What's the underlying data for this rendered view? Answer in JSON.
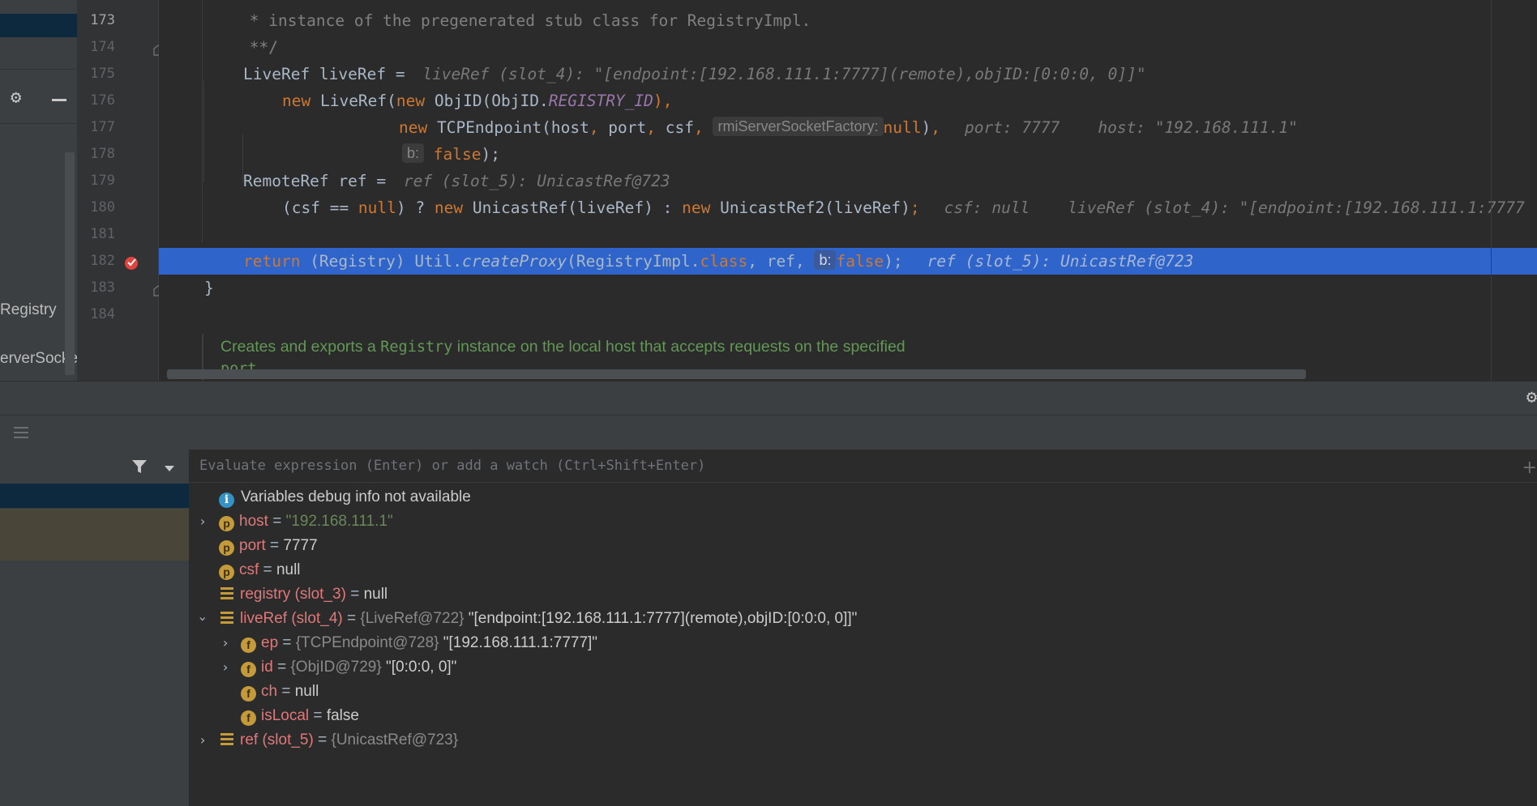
{
  "sidebar": {
    "labels": [
      "Registry",
      "erverSocket"
    ],
    "settings_icon": "gear-icon",
    "hide_icon": "minus-icon"
  },
  "editor": {
    "line_numbers": [
      "173",
      "174",
      "175",
      "176",
      "177",
      "178",
      "179",
      "180",
      "181",
      "182",
      "183",
      "184"
    ],
    "l173": " * instance of the pregenerated stub class for RegistryImpl.",
    "l174": " **/",
    "l175_code": "LiveRef liveRef = ",
    "l175_hint": "liveRef (slot_4): \"[endpoint:[192.168.111.1:7777](remote),objID:[0:0:0, 0]]\"",
    "l176_new1": "new ",
    "l176_a": "LiveRef(",
    "l176_new2": "new ",
    "l176_b": "ObjID(ObjID.",
    "l176_const": "REGISTRY_ID",
    "l176_c": "),",
    "l177_new": "new ",
    "l177_a": "TCPEndpoint(host",
    "l177_comma1": ", ",
    "l177_b": "port",
    "l177_comma2": ", ",
    "l177_c": "csf",
    "l177_comma3": ", ",
    "l177_param": "rmiServerSocketFactory:",
    "l177_null": "null",
    "l177_d": ")",
    "l177_comma4": ",",
    "l177_hint": "port: 7777    host: \"192.168.111.1\"",
    "l178_param": "b:",
    "l178_false": "false",
    "l178_end": ");",
    "l179_code": "RemoteRef ref = ",
    "l179_hint": "ref (slot_5): UnicastRef@723",
    "l180_a": "(csf == ",
    "l180_null": "null",
    "l180_b": ") ? ",
    "l180_new1": "new ",
    "l180_c": "UnicastRef(liveRef) : ",
    "l180_new2": "new ",
    "l180_d": "UnicastRef2(liveRef)",
    "l180_semi": ";",
    "l180_hint": "csf: null    liveRef (slot_4): \"[endpoint:[192.168.111.1:7777",
    "l182_return": "return ",
    "l182_a": "(Registry) Util.",
    "l182_method": "createProxy",
    "l182_b": "(RegistryImpl.",
    "l182_class": "class",
    "l182_c": ", ref, ",
    "l182_param": "b:",
    "l182_false": "false",
    "l182_end": ");",
    "l182_hint": "ref (slot_5): UnicastRef@723",
    "l183": "}",
    "doc_line1_a": "Creates and exports a ",
    "doc_line1_code": "Registry",
    "doc_line1_b": " instance on the local host that accepts requests on the specified",
    "doc_line2": "port."
  },
  "debugger": {
    "eval_placeholder": "Evaluate expression (Enter) or add a watch (Ctrl+Shift+Enter)",
    "info_message": "Variables debug info not available",
    "vars": [
      {
        "name": "host",
        "eq": " = ",
        "value": "\"192.168.111.1\"",
        "kind": "p",
        "expand": true
      },
      {
        "name": "port",
        "eq": " = ",
        "value": "7777",
        "kind": "p"
      },
      {
        "name": "csf",
        "eq": " = ",
        "value": "null",
        "kind": "p"
      },
      {
        "name": "registry (slot_3)",
        "eq": " = ",
        "value": "null",
        "kind": "slot"
      },
      {
        "name": "liveRef (slot_4)",
        "eq": " = ",
        "type": "{LiveRef@722}",
        "value": " \"[endpoint:[192.168.111.1:7777](remote),objID:[0:0:0, 0]]\"",
        "kind": "slot",
        "expanded": true
      },
      {
        "name": "ep",
        "eq": " = ",
        "type": "{TCPEndpoint@728}",
        "value": " \"[192.168.111.1:7777]\"",
        "kind": "f",
        "expand": true
      },
      {
        "name": "id",
        "eq": " = ",
        "type": "{ObjID@729}",
        "value": " \"[0:0:0, 0]\"",
        "kind": "f",
        "expand": true
      },
      {
        "name": "ch",
        "eq": " = ",
        "value": "null",
        "kind": "f"
      },
      {
        "name": "isLocal",
        "eq": " = ",
        "value": "false",
        "kind": "f"
      },
      {
        "name": "ref (slot_5)",
        "eq": " = ",
        "type": "{UnicastRef@723}",
        "kind": "slot",
        "expand": true
      }
    ],
    "badge_p": "p",
    "badge_f": "f",
    "badge_info": "i"
  },
  "colors": {
    "highlight": "#2f65ca",
    "breakpoint": "#e0443e",
    "keyword": "#cc7832",
    "string": "#6a8759",
    "doc": "#629755"
  }
}
